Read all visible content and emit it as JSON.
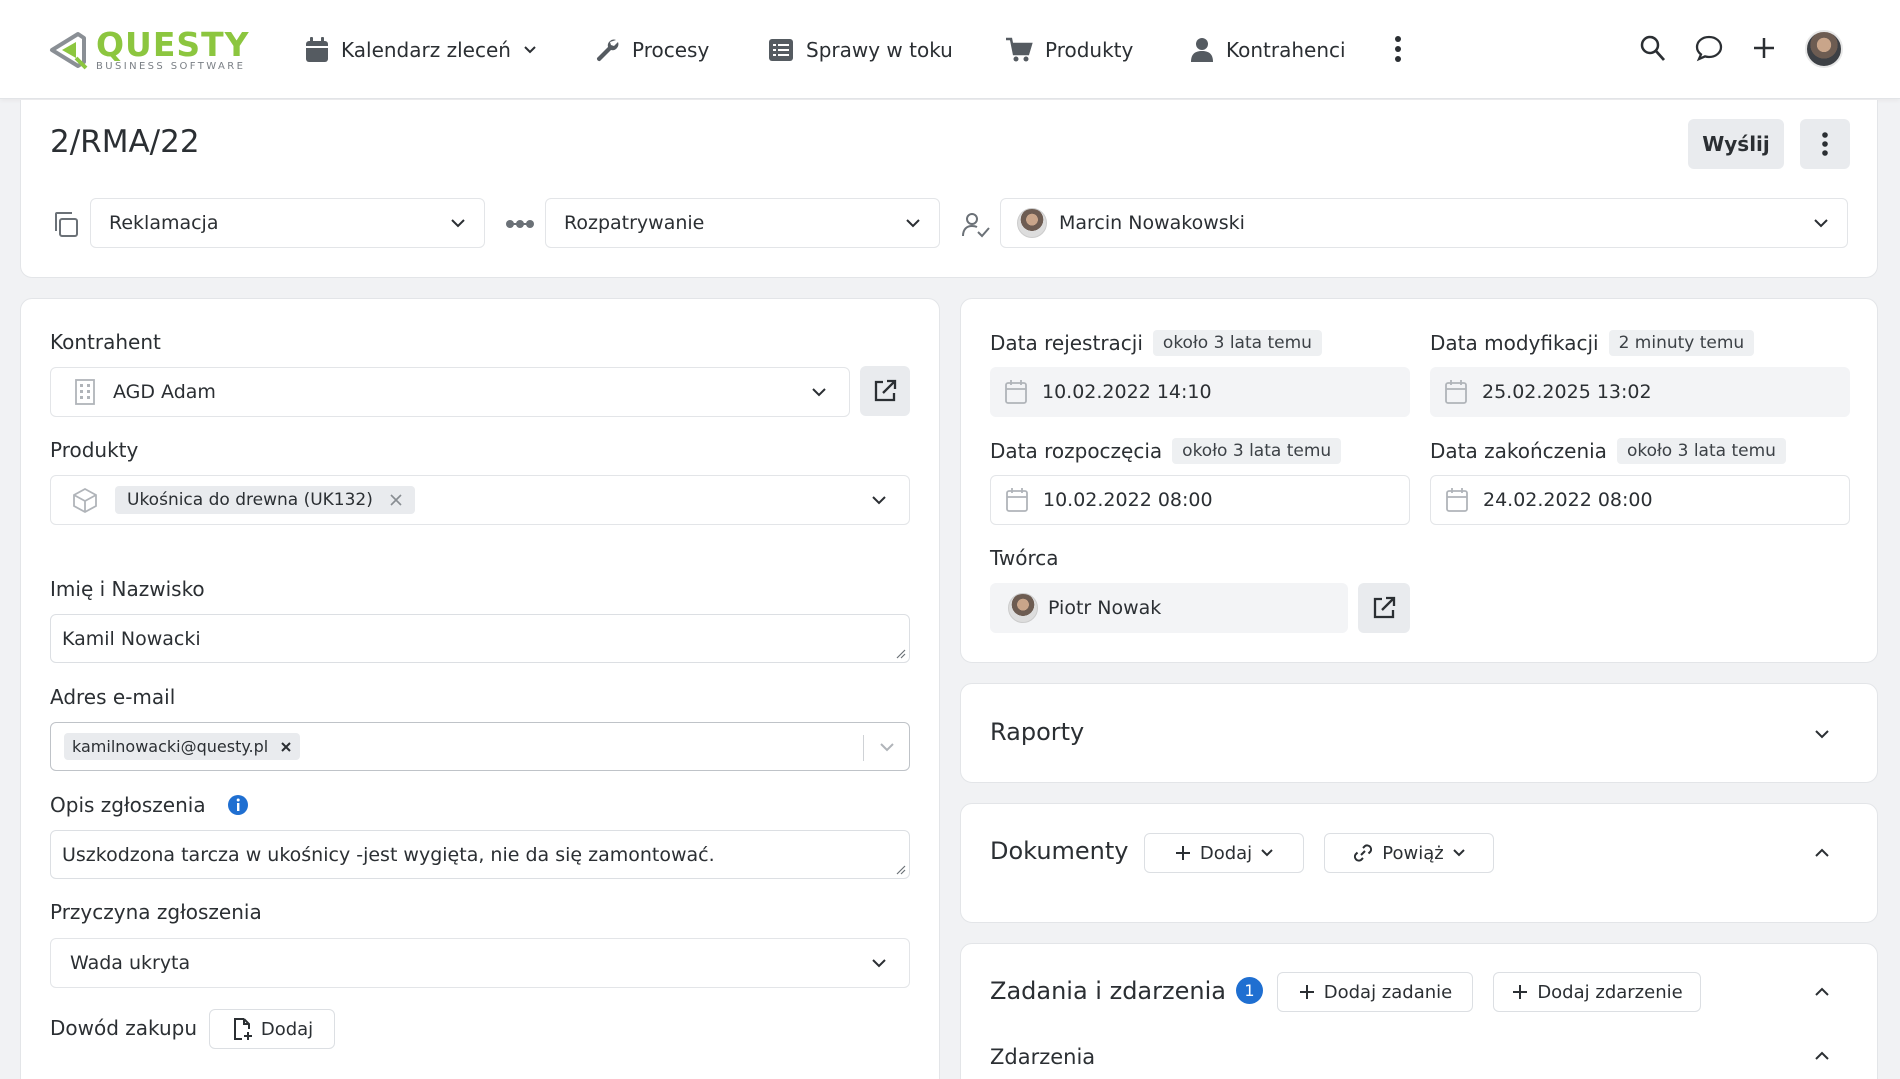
{
  "brand": {
    "name": "QUESTY",
    "tagline": "BUSINESS SOFTWARE",
    "color": "#8cc63f"
  },
  "nav": {
    "items": [
      {
        "label": "Kalendarz zleceń",
        "icon": "calendar-icon"
      },
      {
        "label": "Procesy",
        "icon": "wrench-icon"
      },
      {
        "label": "Sprawy w toku",
        "icon": "list-icon"
      },
      {
        "label": "Produkty",
        "icon": "cart-icon"
      },
      {
        "label": "Kontrahenci",
        "icon": "person-icon"
      }
    ]
  },
  "header": {
    "title": "2/RMA/22",
    "send_label": "Wyślij",
    "type_value": "Reklamacja",
    "status_value": "Rozpatrywanie",
    "assignee_value": "Marcin Nowakowski"
  },
  "left": {
    "contractor_label": "Kontrahent",
    "contractor_value": "AGD Adam",
    "products_label": "Produkty",
    "product_chip": "Ukośnica do drewna (UK132)",
    "name_label": "Imię i Nazwisko",
    "name_value": "Kamil Nowacki",
    "email_label": "Adres e-mail",
    "email_chip": "kamilnowacki@questy.pl",
    "desc_label": "Opis zgłoszenia",
    "desc_value": "Uszkodzona tarcza w ukośnicy -jest wygięta, nie da się zamontować.",
    "reason_label": "Przyczyna zgłoszenia",
    "reason_value": "Wada ukryta",
    "proof_label": "Dowód zakupu",
    "proof_button": "Dodaj"
  },
  "right": {
    "reg_label": "Data rejestracji",
    "reg_badge": "około 3 lata temu",
    "reg_value": "10.02.2022 14:10",
    "mod_label": "Data modyfikacji",
    "mod_badge": "2 minuty temu",
    "mod_value": "25.02.2025 13:02",
    "start_label": "Data rozpoczęcia",
    "start_badge": "około 3 lata temu",
    "start_value": "10.02.2022 08:00",
    "end_label": "Data zakończenia",
    "end_badge": "około 3 lata temu",
    "end_value": "24.02.2022 08:00",
    "creator_label": "Twórca",
    "creator_value": "Piotr Nowak"
  },
  "reports": {
    "title": "Raporty"
  },
  "documents": {
    "title": "Dokumenty",
    "add_label": "Dodaj",
    "link_label": "Powiąż"
  },
  "tasks": {
    "title": "Zadania i zdarzenia",
    "count": "1",
    "add_task_label": "Dodaj zadanie",
    "add_event_label": "Dodaj zdarzenie",
    "events_label": "Zdarzenia"
  },
  "colors": {
    "accent": "#1f6fd1",
    "info": "#1f6fd1"
  }
}
